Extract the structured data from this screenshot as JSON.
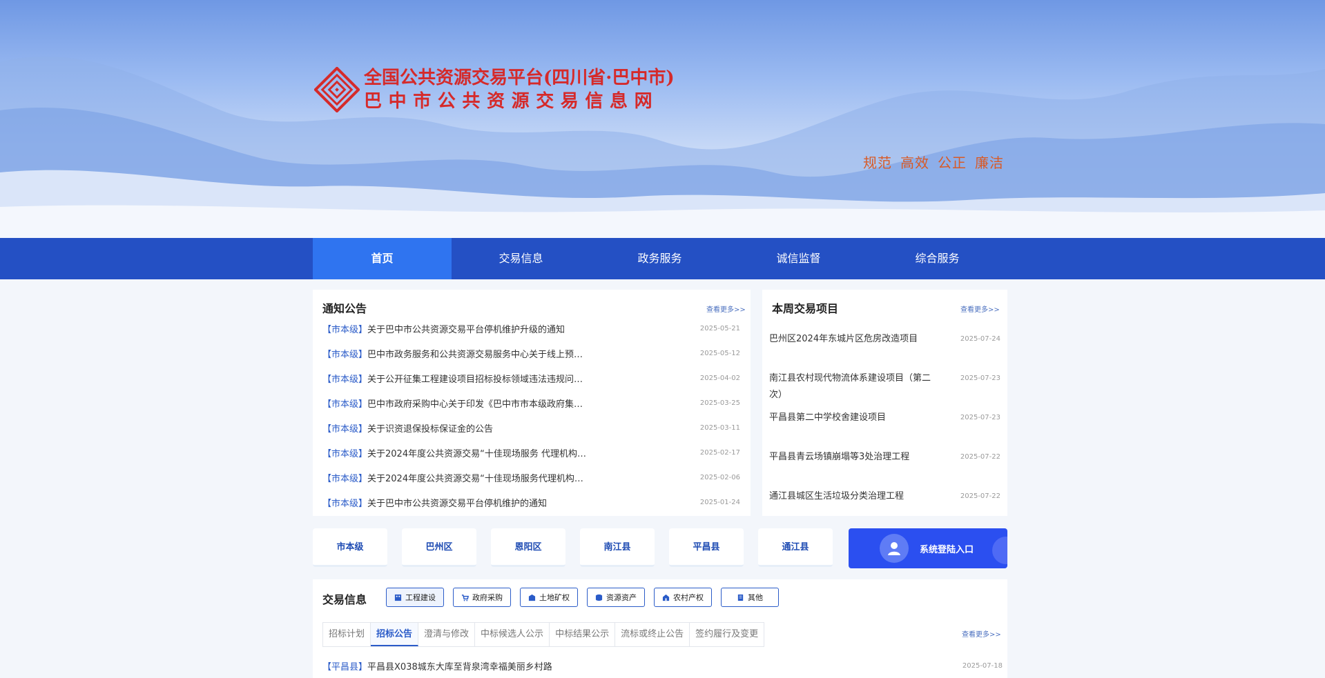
{
  "header": {
    "title_line1": "全国公共资源交易平台(四川省·巴中市)",
    "title_line2": "巴中市公共资源交易信息网",
    "slogan": [
      "规范",
      "高效",
      "公正",
      "廉洁"
    ]
  },
  "nav": {
    "items": [
      "首页",
      "交易信息",
      "政务服务",
      "诚信监督",
      "综合服务"
    ],
    "active_index": 0
  },
  "notice": {
    "title": "通知公告",
    "more": "查看更多>>",
    "items": [
      {
        "tag": "【市本级】",
        "title": "关于巴中市公共资源交易平台停机维护升级的通知",
        "date": "2025-05-21"
      },
      {
        "tag": "【市本级】",
        "title": "巴中市政务服务和公共资源交易服务中心关于线上预…",
        "date": "2025-05-12"
      },
      {
        "tag": "【市本级】",
        "title": "关于公开征集工程建设项目招标投标领域违法违规问…",
        "date": "2025-04-02"
      },
      {
        "tag": "【市本级】",
        "title": "巴中市政府采购中心关于印发《巴中市市本级政府集…",
        "date": "2025-03-25"
      },
      {
        "tag": "【市本级】",
        "title": "关于识资退保投标保证金的公告",
        "date": "2025-03-11"
      },
      {
        "tag": "【市本级】",
        "title": "关于2024年度公共资源交易“十佳现场服务 代理机构…",
        "date": "2025-02-17"
      },
      {
        "tag": "【市本级】",
        "title": "关于2024年度公共资源交易“十佳现场服务代理机构…",
        "date": "2025-02-06"
      },
      {
        "tag": "【市本级】",
        "title": "关于巴中市公共资源交易平台停机维护的通知",
        "date": "2025-01-24"
      }
    ]
  },
  "weekly": {
    "title": "本周交易项目",
    "more": "查看更多>>",
    "items": [
      {
        "title": "巴州区2024年东城片区危房改造项目",
        "date": "2025-07-24"
      },
      {
        "title": "南江县农村现代物流体系建设项目（第二次）",
        "date": "2025-07-23"
      },
      {
        "title": "平昌县第二中学校舍建设项目",
        "date": "2025-07-23"
      },
      {
        "title": "平昌县青云场镇崩塌等3处治理工程",
        "date": "2025-07-22"
      },
      {
        "title": "通江县城区生活垃圾分类治理工程",
        "date": "2025-07-22"
      }
    ]
  },
  "regions": [
    "市本级",
    "巴州区",
    "恩阳区",
    "南江县",
    "平昌县",
    "通江县"
  ],
  "login": {
    "label": "系统登陆入口"
  },
  "trade": {
    "title": "交易信息",
    "categories": [
      {
        "label": "工程建设",
        "icon": "building-icon"
      },
      {
        "label": "政府采购",
        "icon": "cart-icon"
      },
      {
        "label": "土地矿权",
        "icon": "land-icon"
      },
      {
        "label": "资源资产",
        "icon": "database-icon"
      },
      {
        "label": "农村产权",
        "icon": "farm-icon"
      },
      {
        "label": "其他",
        "icon": "document-icon"
      }
    ],
    "subtabs": [
      "招标计划",
      "招标公告",
      "澄清与修改",
      "中标候选人公示",
      "中标结果公示",
      "流标或终止公告",
      "签约履行及变更"
    ],
    "active_subtab": 1,
    "more": "查看更多>>",
    "rows": [
      {
        "tag": "【平昌县】",
        "title": "平昌县X038城东大库至背泉湾幸福美丽乡村路",
        "date": "2025-07-18"
      }
    ]
  },
  "colors": {
    "nav": "#2450c4",
    "nav_active": "#2f74f0",
    "brand_red": "#d52a2a",
    "slogan": "#d85a26",
    "link_blue": "#2a5bc8",
    "login": "#2b4ff0"
  }
}
